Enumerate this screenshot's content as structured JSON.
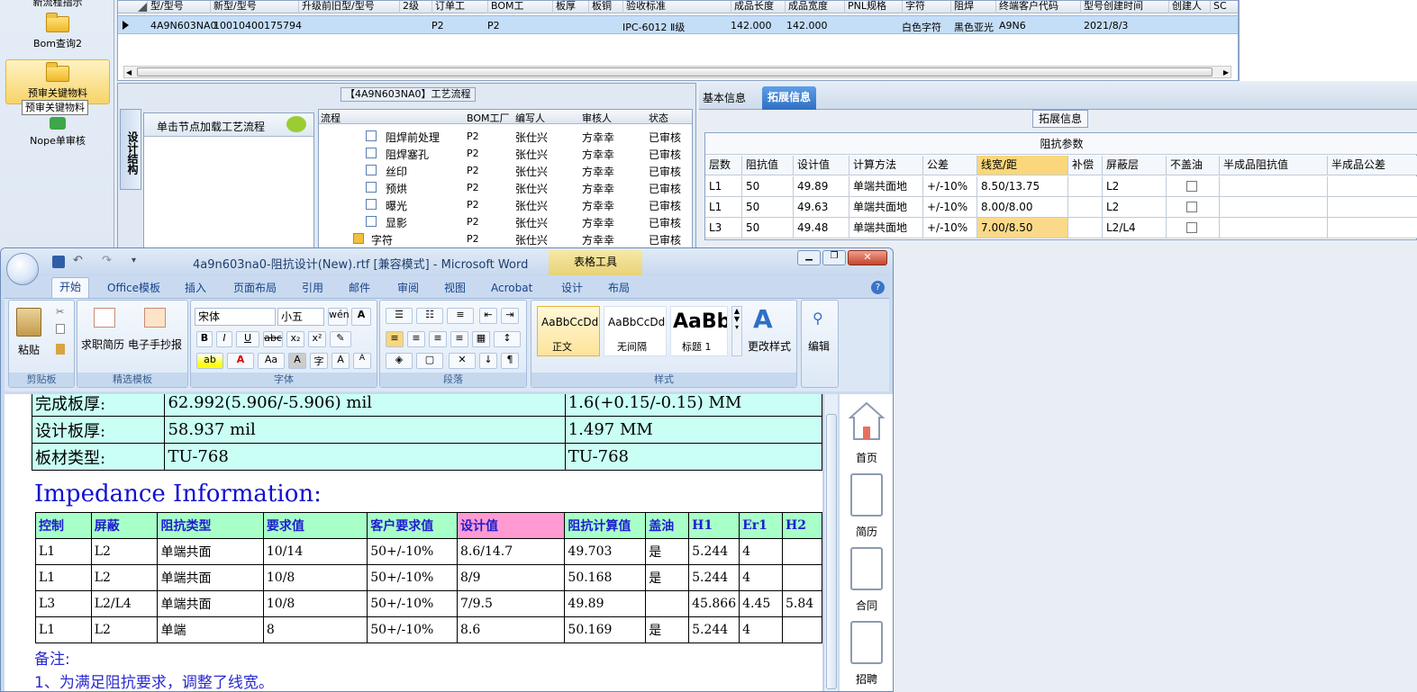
{
  "leftnav": {
    "top_partial": "新流程指示",
    "items": [
      "Bom查询2",
      "预审关键物料",
      "Nope单审核"
    ],
    "tooltip": "预审关键物料"
  },
  "top_grid": {
    "headers": [
      "型/型号",
      "新型/型号",
      "升级前旧型/型号",
      "2级",
      "订单工",
      "BOM工",
      "板厚",
      "板铜",
      "验收标准",
      "成品长度",
      "成品宽度",
      "PNL规格",
      "字符",
      "阻焊",
      "终端客户代码",
      "型号创建时间",
      "创建人",
      "SC"
    ],
    "row": [
      "4A9N603NA0",
      "10010400175794",
      "",
      "",
      "P2",
      "P2",
      "",
      "",
      "IPC-6012 Ⅱ级",
      "142.000",
      "142.000",
      "",
      "白色字符",
      "黑色亚光",
      "A9N6",
      "2021/8/3",
      "",
      ""
    ]
  },
  "process": {
    "title": "【4A9N603NA0】工艺流程",
    "side_tab": "设计结构",
    "hint": "单击节点加载工艺流程",
    "headers": [
      "流程",
      "BOM工厂",
      "编写人",
      "审核人",
      "状态"
    ],
    "rows": [
      [
        "阻焊前处理",
        "P2",
        "张仕兴",
        "方幸幸",
        "已审核"
      ],
      [
        "阻焊塞孔",
        "P2",
        "张仕兴",
        "方幸幸",
        "已审核"
      ],
      [
        "丝印",
        "P2",
        "张仕兴",
        "方幸幸",
        "已审核"
      ],
      [
        "预烘",
        "P2",
        "张仕兴",
        "方幸幸",
        "已审核"
      ],
      [
        "曝光",
        "P2",
        "张仕兴",
        "方幸幸",
        "已审核"
      ],
      [
        "显影",
        "P2",
        "张仕兴",
        "方幸幸",
        "已审核"
      ],
      [
        "字符",
        "P2",
        "张仕兴",
        "方幸幸",
        "已审核"
      ]
    ]
  },
  "ext": {
    "tabs": [
      "基本信息",
      "拓展信息"
    ],
    "group_title": "拓展信息",
    "table_title": "阻抗参数",
    "headers": [
      "层数",
      "阻抗值",
      "设计值",
      "计算方法",
      "公差",
      "线宽/距",
      "补偿",
      "屏蔽层",
      "不盖油",
      "半成品阻抗值",
      "半成品公差"
    ],
    "rows": [
      [
        "L1",
        "50",
        "49.89",
        "单端共面地",
        "+/-10%",
        "8.50/13.75",
        "",
        "L2",
        "",
        "",
        ""
      ],
      [
        "L1",
        "50",
        "49.63",
        "单端共面地",
        "+/-10%",
        "8.00/8.00",
        "",
        "L2",
        "",
        "",
        ""
      ],
      [
        "L3",
        "50",
        "49.48",
        "单端共面地",
        "+/-10%",
        "7.00/8.50",
        "",
        "L2/L4",
        "",
        "",
        ""
      ]
    ]
  },
  "word": {
    "title": "4a9n603na0-阻抗设计(New).rtf [兼容模式] - Microsoft Word",
    "context_tab": "表格工具",
    "tabs": [
      "开始",
      "Office模板",
      "插入",
      "页面布局",
      "引用",
      "邮件",
      "审阅",
      "视图",
      "Acrobat",
      "设计",
      "布局"
    ],
    "groups": {
      "clipboard": "剪贴板",
      "templates": "精选模板",
      "font": "字体",
      "para": "段落",
      "styles": "样式",
      "edit": "编辑"
    },
    "paste": "粘贴",
    "tpl_btns": [
      "求职简历",
      "电子手抄报"
    ],
    "font_name": "宋体",
    "font_size": "小五",
    "styles": [
      {
        "sample": "AaBbCcDd",
        "name": "正文"
      },
      {
        "sample": "AaBbCcDd",
        "name": "无间隔"
      },
      {
        "sample": "AaBb",
        "name": "标题 1"
      }
    ],
    "change_style": "更改样式",
    "edit_btn": "编辑",
    "side_items": [
      "首页",
      "简历",
      "合同",
      "招聘"
    ]
  },
  "doc": {
    "spec_rows": [
      [
        "完成板厚:",
        "62.992(5.906/-5.906) mil",
        "1.6(+0.15/-0.15) MM"
      ],
      [
        "设计板厚:",
        "58.937 mil",
        "1.497 MM"
      ],
      [
        "板材类型:",
        "TU-768",
        "TU-768"
      ]
    ],
    "heading": "Impedance Information:",
    "imp_headers": [
      "控制",
      "屏蔽",
      "阻抗类型",
      "要求值",
      "客户要求值",
      "设计值",
      "阻抗计算值",
      "盖油",
      "H1",
      "Er1",
      "H2"
    ],
    "imp_rows": [
      [
        "L1",
        "L2",
        "单端共面",
        "10/14",
        "50+/-10%",
        "8.6/14.7",
        "49.703",
        "是",
        "5.244",
        "4",
        ""
      ],
      [
        "L1",
        "L2",
        "单端共面",
        "10/8",
        "50+/-10%",
        "8/9",
        "50.168",
        "是",
        "5.244",
        "4",
        ""
      ],
      [
        "L3",
        "L2/L4",
        "单端共面",
        "10/8",
        "50+/-10%",
        "7/9.5",
        "49.89",
        "",
        "45.866",
        "4.45",
        "5.84"
      ],
      [
        "L1",
        "L2",
        "单端",
        "8",
        "50+/-10%",
        "8.6",
        "50.169",
        "是",
        "5.244",
        "4",
        ""
      ]
    ],
    "note_title": "备注:",
    "note_1": "1、为满足阻抗要求，调整了线宽。"
  }
}
